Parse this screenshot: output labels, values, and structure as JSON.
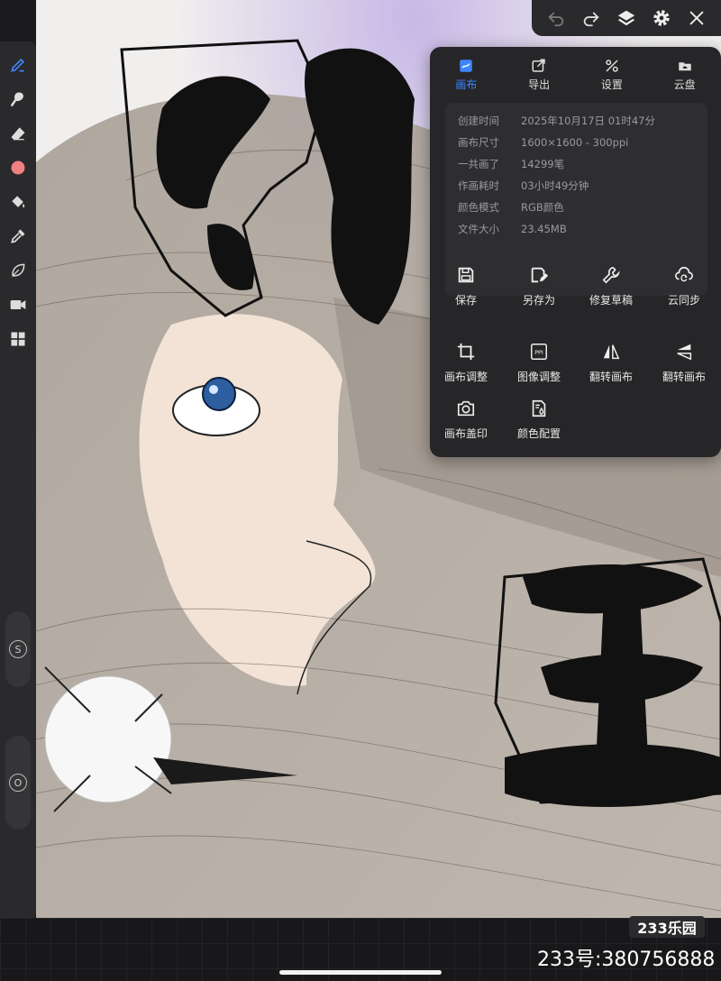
{
  "topbar": {
    "buttons": [
      "undo-icon",
      "redo-icon",
      "layers-icon",
      "settings-icon",
      "close-icon"
    ]
  },
  "left_tools": {
    "items": [
      "pen-icon",
      "smudge-icon",
      "eraser-icon",
      "color-swatch",
      "fill-icon",
      "eyedropper-icon",
      "leaf-icon",
      "video-icon",
      "grid-icon"
    ],
    "active_color": "#f08080",
    "size_slider_label": "S",
    "opacity_slider_label": "O"
  },
  "panel": {
    "tabs": [
      {
        "label": "画布",
        "icon": "canvas-icon",
        "active": true
      },
      {
        "label": "导出",
        "icon": "export-icon",
        "active": false
      },
      {
        "label": "设置",
        "icon": "tools-icon",
        "active": false
      },
      {
        "label": "云盘",
        "icon": "cloud-drive-icon",
        "active": false
      }
    ],
    "info": [
      {
        "key": "创建时间",
        "value": "2025年10月17日 01时47分"
      },
      {
        "key": "画布尺寸",
        "value": "1600×1600 - 300ppi"
      },
      {
        "key": "一共画了",
        "value": "14299笔"
      },
      {
        "key": "作画耗时",
        "value": "03小时49分钟"
      },
      {
        "key": "颜色模式",
        "value": "RGB颜色"
      },
      {
        "key": "文件大小",
        "value": "23.45MB"
      }
    ],
    "actions": [
      {
        "label": "保存",
        "icon": "save-icon"
      },
      {
        "label": "另存为",
        "icon": "save-as-icon"
      },
      {
        "label": "修复草稿",
        "icon": "wrench-icon"
      },
      {
        "label": "云同步",
        "icon": "cloud-sync-icon"
      },
      {
        "label": "画布调整",
        "icon": "crop-icon"
      },
      {
        "label": "图像调整",
        "icon": "ppi-icon"
      },
      {
        "label": "翻转画布",
        "icon": "flip-horizontal-icon"
      },
      {
        "label": "翻转画布",
        "icon": "flip-vertical-icon"
      },
      {
        "label": "画布盖印",
        "icon": "camera-icon"
      },
      {
        "label": "颜色配置",
        "icon": "color-config-icon"
      }
    ],
    "accent": "#3d86ff"
  },
  "watermark": {
    "logo": "233乐园",
    "id_text": "233号:380756888"
  }
}
